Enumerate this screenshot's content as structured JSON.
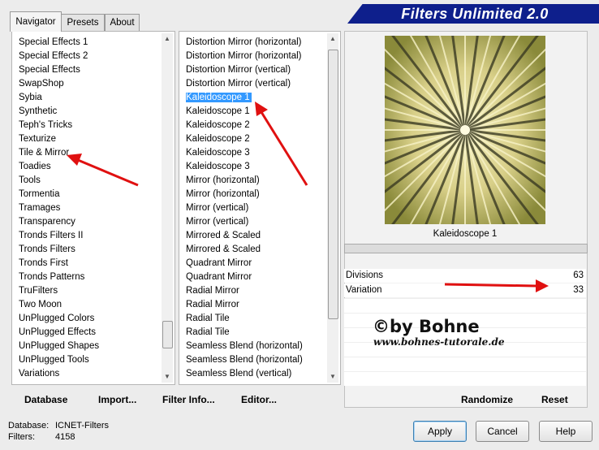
{
  "tabs": [
    "Navigator",
    "Presets",
    "About"
  ],
  "banner_title": "Filters Unlimited 2.0",
  "categories": [
    "Special Effects 1",
    "Special Effects 2",
    "Special Effects",
    "SwapShop",
    "Sybia",
    "Synthetic",
    "Teph's Tricks",
    "Texturize",
    "Tile & Mirror",
    "Toadies",
    "Tools",
    "Tormentia",
    "Tramages",
    "Transparency",
    "Tronds Filters II",
    "Tronds Filters",
    "Tronds First",
    "Tronds Patterns",
    "TruFilters",
    "Two Moon",
    "UnPlugged Colors",
    "UnPlugged Effects",
    "UnPlugged Shapes",
    "UnPlugged Tools",
    "Variations"
  ],
  "filters": [
    "Distortion Mirror (horizontal)",
    "Distortion Mirror (horizontal)",
    "Distortion Mirror (vertical)",
    "Distortion Mirror (vertical)",
    "Kaleidoscope 1",
    "Kaleidoscope 1",
    "Kaleidoscope 2",
    "Kaleidoscope 2",
    "Kaleidoscope 3",
    "Kaleidoscope 3",
    "Mirror (horizontal)",
    "Mirror (horizontal)",
    "Mirror (vertical)",
    "Mirror (vertical)",
    "Mirrored & Scaled",
    "Mirrored & Scaled",
    "Quadrant Mirror",
    "Quadrant Mirror",
    "Radial Mirror",
    "Radial Mirror",
    "Radial Tile",
    "Radial Tile",
    "Seamless Blend (horizontal)",
    "Seamless Blend (horizontal)",
    "Seamless Blend (vertical)"
  ],
  "selected_filter_index": 4,
  "filter_name": "Kaleidoscope 1",
  "params": [
    {
      "name": "Divisions",
      "value": "63"
    },
    {
      "name": "Variation",
      "value": "33"
    }
  ],
  "toolbar": {
    "database": "Database",
    "import": "Import...",
    "filter_info": "Filter Info...",
    "editor": "Editor..."
  },
  "right_buttons": {
    "randomize": "Randomize",
    "reset": "Reset"
  },
  "status": {
    "db_label": "Database:",
    "db_value": "ICNET-Filters",
    "filters_label": "Filters:",
    "filters_value": "4158"
  },
  "dialog_buttons": {
    "apply": "Apply",
    "cancel": "Cancel",
    "help": "Help"
  },
  "watermark": {
    "line1": "©by Bohne",
    "line2": "www.bohnes-tutorale.de"
  },
  "colors": {
    "banner": "#0e1f8c",
    "selection": "#3399ff",
    "arrow": "#e01010"
  }
}
